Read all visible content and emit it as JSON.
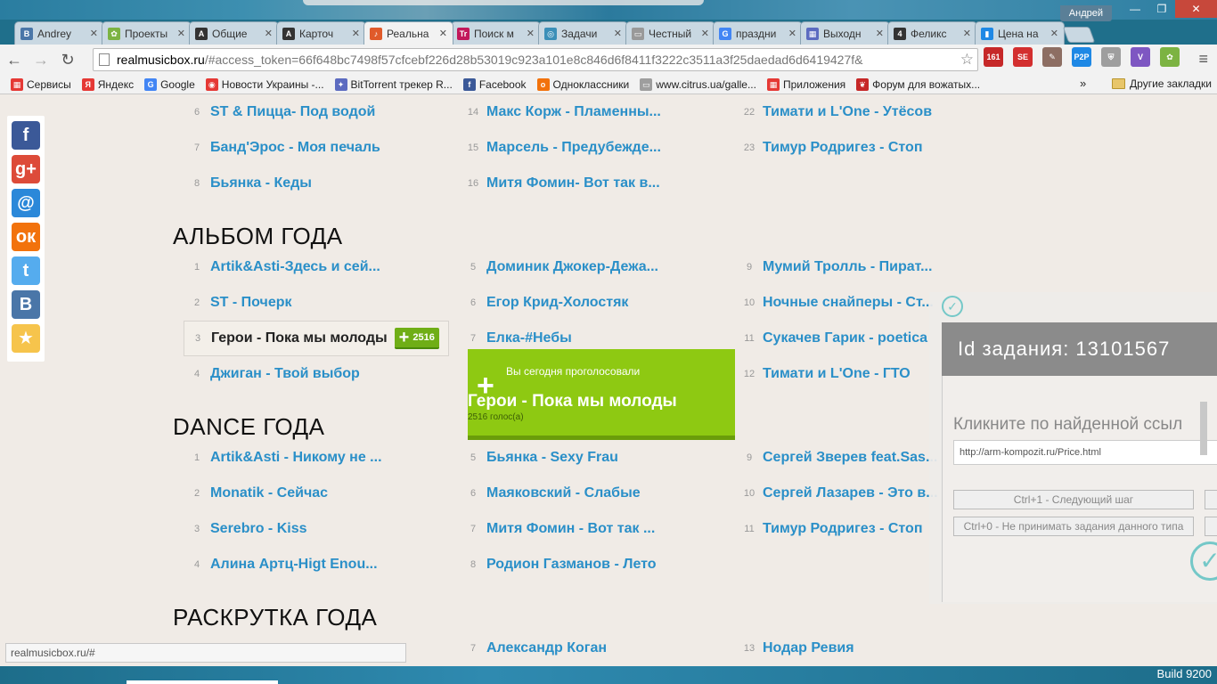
{
  "window": {
    "user": "Андрей"
  },
  "tabs": [
    {
      "label": "Andrey",
      "icon": "В",
      "color": "#4a76a8"
    },
    {
      "label": "Проекты",
      "icon": "✿",
      "color": "#7cb342"
    },
    {
      "label": "Общие",
      "icon": "A",
      "color": "#333333"
    },
    {
      "label": "Карточ",
      "icon": "A",
      "color": "#333333"
    },
    {
      "label": "Реальна",
      "icon": "♪",
      "color": "#e05a2a",
      "active": true
    },
    {
      "label": "Поиск м",
      "icon": "Tr",
      "color": "#c2185b"
    },
    {
      "label": "Задачи",
      "icon": "◎",
      "color": "#3b8fb8"
    },
    {
      "label": "Честный",
      "icon": "▭",
      "color": "#999999"
    },
    {
      "label": "праздни",
      "icon": "G",
      "color": "#4285f4"
    },
    {
      "label": "Выходн",
      "icon": "▦",
      "color": "#5c6bc0"
    },
    {
      "label": "Феликс",
      "icon": "4",
      "color": "#333333"
    },
    {
      "label": "Цена на",
      "icon": "▮",
      "color": "#1e88e5"
    }
  ],
  "url": {
    "host": "realmusicbox.ru",
    "rest": "/#access_token=66f648bc7498f57cfcebf226d28b53019c923a101e8c846d6f8411f3222c3511a3f25daedad6d6419427f&"
  },
  "extensions": [
    {
      "label": "161",
      "color": "#c62828"
    },
    {
      "label": "SE",
      "color": "#d32f2f"
    },
    {
      "label": "✎",
      "color": "#8d6e63"
    },
    {
      "label": "P2P",
      "color": "#1e88e5"
    },
    {
      "label": "⛨",
      "color": "#9e9e9e"
    },
    {
      "label": "V",
      "color": "#7e57c2"
    },
    {
      "label": "✿",
      "color": "#7cb342"
    }
  ],
  "bookmarks": [
    {
      "label": "Сервисы",
      "icon": "▦",
      "color": "#e53935"
    },
    {
      "label": "Яндекс",
      "icon": "Я",
      "color": "#e53935"
    },
    {
      "label": "Google",
      "icon": "G",
      "color": "#4285f4"
    },
    {
      "label": "Новости Украины -...",
      "icon": "◉",
      "color": "#e53935"
    },
    {
      "label": "BitTorrent трекер R...",
      "icon": "✦",
      "color": "#5c6bc0"
    },
    {
      "label": "Facebook",
      "icon": "f",
      "color": "#3b5998"
    },
    {
      "label": "Одноклассники",
      "icon": "о",
      "color": "#f2720c"
    },
    {
      "label": "www.citrus.ua/galle...",
      "icon": "▭",
      "color": "#9e9e9e"
    },
    {
      "label": "Приложения",
      "icon": "▦",
      "color": "#e53935"
    },
    {
      "label": "Форум для вожатых...",
      "icon": "❦",
      "color": "#c62828"
    }
  ],
  "bookmarks_more": "»",
  "bookmarks_other": "Другие закладки",
  "share": [
    {
      "icon": "f",
      "color": "#3b5998",
      "name": "facebook-icon"
    },
    {
      "icon": "g+",
      "color": "#dd4b39",
      "name": "google-plus-icon"
    },
    {
      "icon": "@",
      "color": "#2b88d9",
      "name": "mail-icon"
    },
    {
      "icon": "ок",
      "color": "#f2720c",
      "name": "odnoklassniki-icon"
    },
    {
      "icon": "t",
      "color": "#55acee",
      "name": "twitter-icon"
    },
    {
      "icon": "B",
      "color": "#4a76a8",
      "name": "vk-icon"
    },
    {
      "icon": "★",
      "color": "#f6c44c",
      "name": "favorite-icon"
    }
  ],
  "sections": {
    "album": "АЛЬБОМ ГОДА",
    "dance": "DANCE ГОДА",
    "promo": "РАСКРУТКА ГОДА"
  },
  "rows_top": [
    [
      {
        "n": "6",
        "t": "ST & Пицца- Под водой"
      },
      {
        "n": "14",
        "t": "Макс Корж - Пламенны..."
      },
      {
        "n": "22",
        "t": "Тимати и L'One - Утёсов"
      }
    ],
    [
      {
        "n": "7",
        "t": "Банд'Эрос - Моя печаль"
      },
      {
        "n": "15",
        "t": "Марсель - Предубежде..."
      },
      {
        "n": "23",
        "t": "Тимур Родригез - Стоп"
      }
    ],
    [
      {
        "n": "8",
        "t": "Бьянка - Кеды"
      },
      {
        "n": "16",
        "t": "Митя Фомин- Вот так в..."
      },
      null
    ]
  ],
  "rows_album": [
    [
      {
        "n": "1",
        "t": "Artik&Asti-Здесь и сей..."
      },
      {
        "n": "5",
        "t": "Доминик Джокер-Дежа..."
      },
      {
        "n": "9",
        "t": "Мумий Тролль - Пират..."
      }
    ],
    [
      {
        "n": "2",
        "t": "ST - Почерк"
      },
      {
        "n": "6",
        "t": "Егор Крид-Холостяк"
      },
      {
        "n": "10",
        "t": "Ночные снайперы - Ст..."
      }
    ],
    [
      {
        "n": "3",
        "t": "Герои - Пока мы молоды",
        "votes": "2516"
      },
      {
        "n": "7",
        "t": "Елка-#Небы"
      },
      {
        "n": "11",
        "t": "Сукачев Гарик - poetica"
      }
    ],
    [
      {
        "n": "4",
        "t": "Джиган - Твой выбор"
      },
      null,
      {
        "n": "12",
        "t": "Тимати и L'One - ГТО"
      }
    ]
  ],
  "rows_dance": [
    [
      {
        "n": "1",
        "t": "Artik&Asti - Никому не ..."
      },
      {
        "n": "5",
        "t": "Бьянка - Sexy Frau"
      },
      {
        "n": "9",
        "t": "Сергей Зверев feat.Sas..."
      }
    ],
    [
      {
        "n": "2",
        "t": "Monatik - Сейчас"
      },
      {
        "n": "6",
        "t": "Маяковский - Слабые"
      },
      {
        "n": "10",
        "t": "Сергей Лазарев - Это в..."
      }
    ],
    [
      {
        "n": "3",
        "t": "Serebro - Kiss"
      },
      {
        "n": "7",
        "t": "Митя Фомин - Вот так ..."
      },
      {
        "n": "11",
        "t": "Тимур Родригез - Стоп"
      }
    ],
    [
      {
        "n": "4",
        "t": "Алина Артц-Higt Enou..."
      },
      {
        "n": "8",
        "t": "Родион Газманов - Лето"
      },
      null
    ]
  ],
  "rows_promo": [
    [
      null,
      {
        "n": "7",
        "t": "Александр Коган"
      },
      {
        "n": "13",
        "t": "Нодар Ревия"
      }
    ]
  ],
  "voted": {
    "subtitle": "Вы сегодня проголосовали",
    "plus": "+",
    "title": "Герои - Пока мы молоды",
    "count": "2516 голос(а)"
  },
  "task": {
    "id_label": "Id задания: 13101567",
    "hint": "Кликните по найденной ссыл",
    "url": "http://arm-kompozit.ru/Price.html",
    "next": "Ctrl+1 - Следующий шаг",
    "reject": "Ctrl+0 - Не принимать задания данного типа"
  },
  "status_url": "realmusicbox.ru/#",
  "taskbar": {
    "build": "Build 9200"
  }
}
